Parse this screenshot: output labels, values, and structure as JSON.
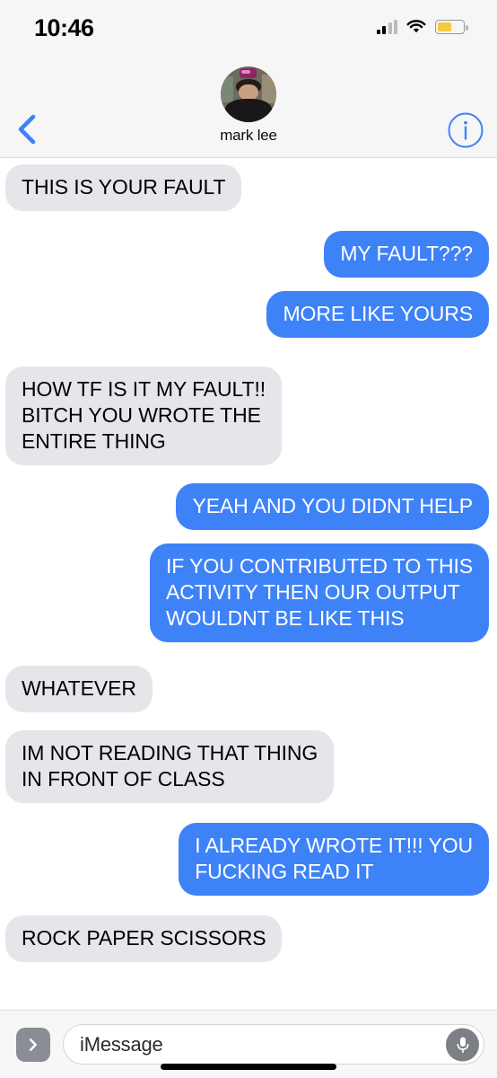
{
  "status_bar": {
    "time": "10:46",
    "signal_icon": "cellular-signal-icon",
    "signal_bars_total": 4,
    "signal_bars_active": 2,
    "wifi_icon": "wifi-icon",
    "battery_icon": "battery-icon",
    "battery_percent": 55,
    "battery_color": "#f6ca3e"
  },
  "nav_header": {
    "back_icon": "back-chevron-icon",
    "info_icon": "info-circle-icon",
    "contact_name": "mark lee",
    "avatar_icon": "contact-avatar-photo",
    "accent_color": "#3e82f7",
    "background_color": "#f6f6f6"
  },
  "conversation": {
    "incoming_bubble_color": "#e6e5ea",
    "outgoing_bubble_color": "#3e82f7",
    "messages": [
      {
        "sender": "incoming",
        "text": "THIS IS YOUR FAULT"
      },
      {
        "sender": "outgoing",
        "text": "MY FAULT???"
      },
      {
        "sender": "outgoing",
        "text": "MORE LIKE YOURS"
      },
      {
        "sender": "incoming",
        "text": "HOW TF IS IT MY FAULT!!\nBITCH YOU WROTE THE\nENTIRE THING"
      },
      {
        "sender": "outgoing",
        "text": "YEAH AND YOU DIDNT HELP"
      },
      {
        "sender": "outgoing",
        "text": "IF YOU CONTRIBUTED TO THIS\nACTIVITY THEN OUR OUTPUT\nWOULDNT BE LIKE THIS"
      },
      {
        "sender": "incoming",
        "text": "WHATEVER"
      },
      {
        "sender": "incoming",
        "text": "IM NOT READING THAT THING\nIN FRONT OF CLASS"
      },
      {
        "sender": "outgoing",
        "text": "I ALREADY WROTE IT!!! YOU\nFUCKING READ IT"
      },
      {
        "sender": "incoming",
        "text": "ROCK PAPER SCISSORS"
      }
    ]
  },
  "input_bar": {
    "apps_icon": "app-drawer-chevron-icon",
    "placeholder": "iMessage",
    "value": "",
    "mic_icon": "microphone-icon"
  }
}
